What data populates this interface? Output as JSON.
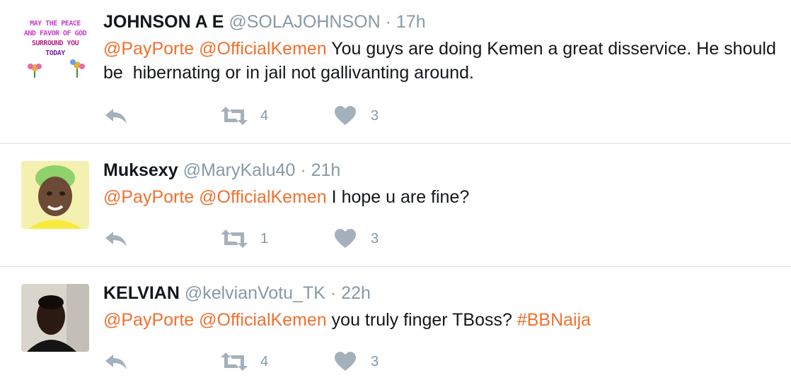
{
  "tweets": [
    {
      "name": "JOHNSON A E",
      "handle": "@SOLAJOHNSON",
      "time": "17h",
      "avatar_text": [
        "MAY THE PEACE",
        "AND FAVOR OF GOD",
        "SURROUND YOU",
        "TODAY"
      ],
      "mentions": [
        "@PayPorte",
        "@OfficialKemen"
      ],
      "text": "You guys are doing Kemen a great disservice. He should be  hibernating or in jail not gallivanting around.",
      "retweets": "4",
      "likes": "3"
    },
    {
      "name": "Muksexy",
      "handle": "@MaryKalu40",
      "time": "21h",
      "mentions": [
        "@PayPorte",
        "@OfficialKemen"
      ],
      "text": "I hope u are fine?",
      "retweets": "1",
      "likes": "3"
    },
    {
      "name": "KELVIAN",
      "handle": "@kelvianVotu_TK",
      "time": "22h",
      "mentions": [
        "@PayPorte",
        "@OfficialKemen"
      ],
      "text": "you truly finger TBoss?",
      "hashtag": "#BBNaija",
      "retweets": "4",
      "likes": "3"
    }
  ],
  "separator": "·",
  "icons": {
    "reply": "reply-icon",
    "retweet": "retweet-icon",
    "like": "heart-icon"
  },
  "colors": {
    "link": "#f0702e",
    "muted": "#8899a6",
    "text": "#14171a",
    "divider": "#e6ecf0"
  }
}
